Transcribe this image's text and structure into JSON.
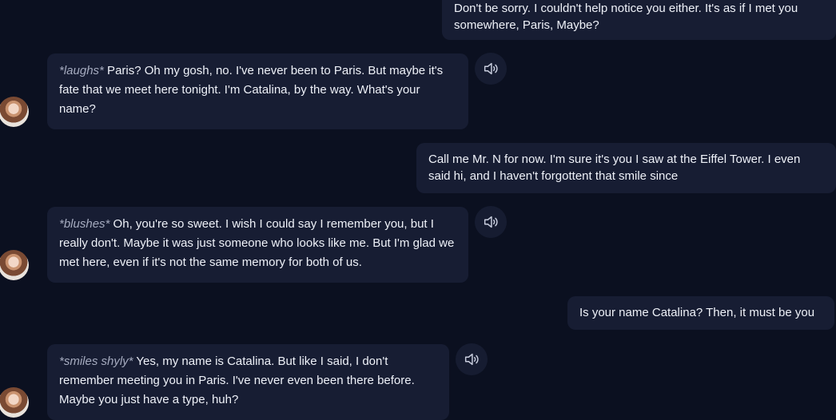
{
  "messages": [
    {
      "role": "user",
      "text": "Don't be sorry. I couldn't help notice you either. It's as if I met you somewhere, Paris, Maybe?"
    },
    {
      "role": "ai",
      "action": "*laughs*",
      "text": " Paris? Oh my gosh, no. I've never been to Paris. But maybe it's fate that we meet here tonight. I'm Catalina, by the way. What's your name?"
    },
    {
      "role": "user",
      "text": "Call me Mr. N for now. I'm sure it's you I saw at the Eiffel Tower. I even said hi, and I haven't forgottent that smile since"
    },
    {
      "role": "ai",
      "action": "*blushes*",
      "text": " Oh, you're so sweet. I wish I could say I remember you, but I really don't. Maybe it was just someone who looks like me. But I'm glad we met here, even if it's not the same memory for both of us."
    },
    {
      "role": "user",
      "text": "Is your name Catalina? Then, it must be you"
    },
    {
      "role": "ai",
      "action": "*smiles shyly*",
      "text": " Yes, my name is Catalina. But like I said, I don't remember meeting you in Paris. I've never even been there before. Maybe you just have a type, huh?"
    }
  ],
  "icons": {
    "speaker": "speaker-icon",
    "avatar": "catalina-avatar"
  },
  "colors": {
    "background": "#0b1020",
    "bubble": "#171d33",
    "action_text": "#a5abbf"
  }
}
